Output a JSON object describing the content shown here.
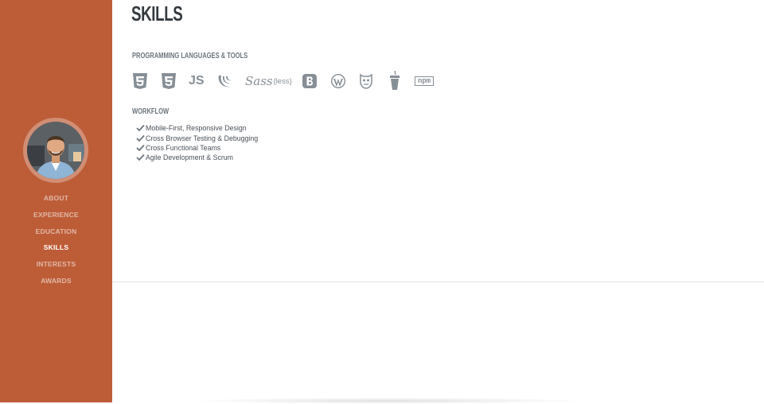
{
  "sidebar": {
    "nav": [
      {
        "label": "About"
      },
      {
        "label": "Experience"
      },
      {
        "label": "Education"
      },
      {
        "label": "Skills",
        "active": true
      },
      {
        "label": "Interests"
      },
      {
        "label": "Awards"
      }
    ]
  },
  "skills": {
    "title": "SKILLS",
    "languages_heading": "Programming Languages & Tools",
    "icons": [
      "html5-icon",
      "css3-icon",
      "js-icon",
      "jquery-icon",
      "sass-icon",
      "less-icon",
      "bootstrap-icon",
      "wordpress-icon",
      "grunt-icon",
      "gulp-icon",
      "npm-icon"
    ],
    "less_text": "{less}",
    "js_text": "JS",
    "npm_text": "npm",
    "sass_text": "Sass",
    "workflow_heading": "Workflow",
    "workflow": [
      "Mobile-First, Responsive Design",
      "Cross Browser Testing & Debugging",
      "Cross Functional Teams",
      "Agile Development & Scrum"
    ]
  },
  "colors": {
    "sidebar": "#bd5d38",
    "heading": "#343a40",
    "icon": "#868e96"
  }
}
